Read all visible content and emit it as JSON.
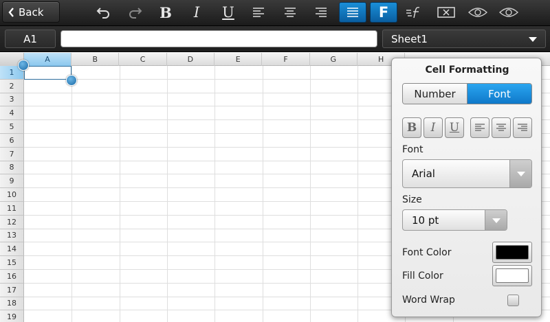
{
  "toolbar": {
    "back_label": "Back",
    "buttons": [
      {
        "name": "undo-icon"
      },
      {
        "name": "redo-icon"
      },
      {
        "name": "bold-icon",
        "glyph": "B"
      },
      {
        "name": "italic-icon",
        "glyph": "I"
      },
      {
        "name": "underline-icon",
        "glyph": "U"
      },
      {
        "name": "align-left-icon"
      },
      {
        "name": "align-center-icon"
      },
      {
        "name": "align-right-icon"
      },
      {
        "name": "justify-icon"
      },
      {
        "name": "cell-format-icon",
        "glyph": "F"
      },
      {
        "name": "function-icon"
      },
      {
        "name": "clear-cell-icon"
      },
      {
        "name": "eye-icon"
      },
      {
        "name": "eye-icon"
      }
    ]
  },
  "formula_bar": {
    "cell_reference": "A1",
    "formula_value": "",
    "sheet_name": "Sheet1"
  },
  "grid": {
    "columns": [
      "A",
      "B",
      "C",
      "D",
      "E",
      "F",
      "G",
      "H"
    ],
    "rows": [
      "1",
      "2",
      "3",
      "4",
      "5",
      "6",
      "7",
      "8",
      "9",
      "10",
      "11",
      "12",
      "13",
      "14",
      "15",
      "16",
      "17",
      "18",
      "19"
    ],
    "selected_column": "A",
    "selected_row": "1"
  },
  "panel": {
    "title": "Cell Formatting",
    "tabs": [
      {
        "label": "Number",
        "active": false
      },
      {
        "label": "Font",
        "active": true
      }
    ],
    "font_label": "Font",
    "font_value": "Arial",
    "size_label": "Size",
    "size_value": "10 pt",
    "font_color_label": "Font Color",
    "font_color": "#000000",
    "fill_color_label": "Fill Color",
    "fill_color": "#ffffff",
    "word_wrap_label": "Word Wrap",
    "word_wrap_checked": false
  },
  "colors": {
    "accent": "#1a8fd8",
    "toolbar_bg": "#2a2a2a"
  }
}
